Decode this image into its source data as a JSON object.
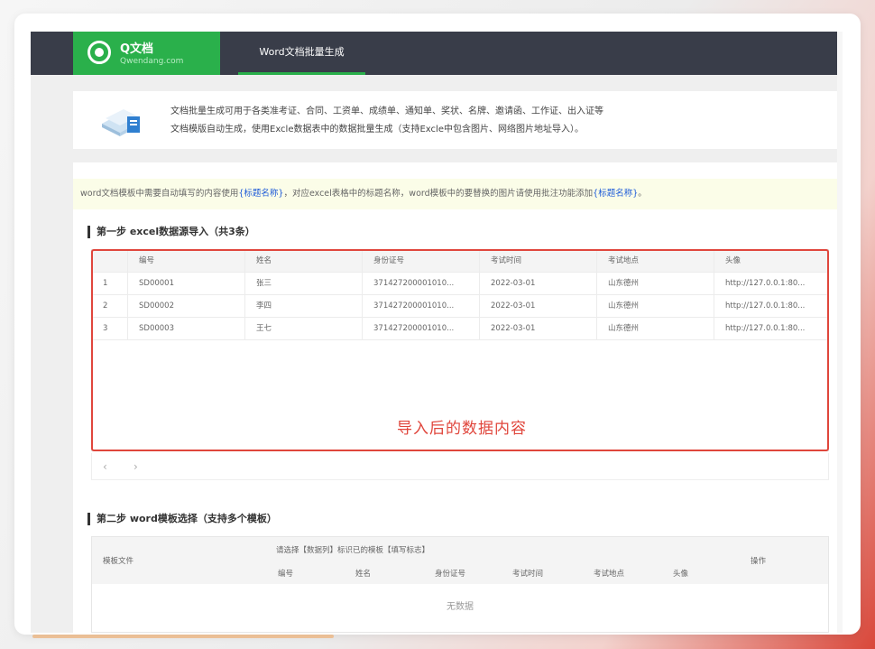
{
  "header": {
    "logo_name": "Q文档",
    "logo_sub": "Qwendang.com",
    "tab": "Word文档批量生成"
  },
  "intro": {
    "line1": "文档批量生成可用于各类准考证、合同、工资单、成绩单、通知单、奖状、名牌、邀请函、工作证、出入证等",
    "line2": "文档模版自动生成，使用Excle数据表中的数据批量生成（支持Excle中包含图片、网络图片地址导入）。"
  },
  "notice": {
    "part1": "word文档模板中需要自动填写的内容使用",
    "hl1": "{标题名称}",
    "part2": "，对应excel表格中的标题名称，word模板中的要替换的图片请使用批注功能添加",
    "hl2": "{标题名称}",
    "part3": "。"
  },
  "step1": {
    "title": "第一步 excel数据源导入（共3条）",
    "columns": [
      "",
      "编号",
      "姓名",
      "身份证号",
      "考试时间",
      "考试地点",
      "头像"
    ],
    "rows": [
      [
        "1",
        "SD00001",
        "张三",
        "371427200001010...",
        "2022-03-01",
        "山东德州",
        "http://127.0.0.1:80..."
      ],
      [
        "2",
        "SD00002",
        "李四",
        "371427200001010...",
        "2022-03-01",
        "山东德州",
        "http://127.0.0.1:80..."
      ],
      [
        "3",
        "SD00003",
        "王七",
        "371427200001010...",
        "2022-03-01",
        "山东德州",
        "http://127.0.0.1:80..."
      ]
    ],
    "annotation": "导入后的数据内容",
    "pager_prev": "‹",
    "pager_next": "›"
  },
  "step2": {
    "title": "第二步 word模板选择（支持多个模板）",
    "col_template": "模板文件",
    "group_label": "请选择【数据列】标识已的模板【填写标志】",
    "sub_columns": [
      "编号",
      "姓名",
      "身份证号",
      "考试时间",
      "考试地点",
      "头像"
    ],
    "col_action": "操作",
    "empty": "无数据"
  },
  "colors": {
    "topbar": "#393d49",
    "brand_green": "#2ab04b",
    "highlight_red": "#e0463c",
    "link_blue": "#1e5bd8"
  }
}
